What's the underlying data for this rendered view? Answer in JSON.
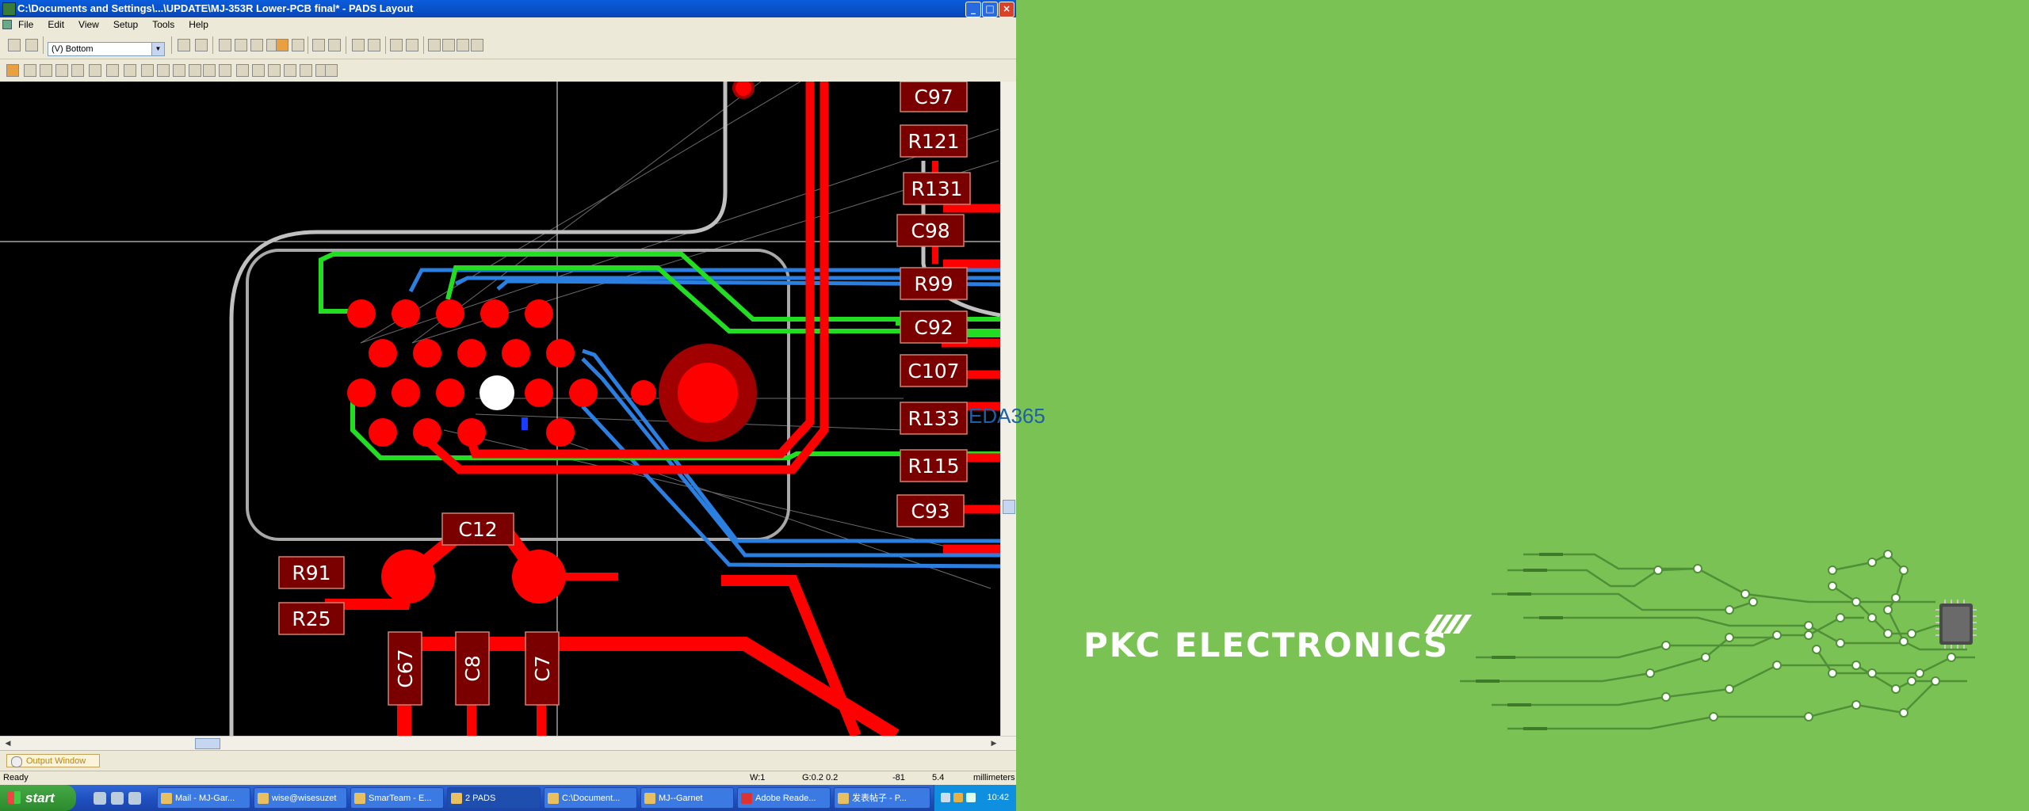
{
  "window": {
    "title": "C:\\Documents and Settings\\...\\UPDATE\\MJ-353R Lower-PCB final* - PADS Layout",
    "controls": [
      "_",
      "□",
      "×"
    ]
  },
  "menu": {
    "items": [
      "File",
      "Edit",
      "View",
      "Setup",
      "Tools",
      "Help"
    ]
  },
  "toolbar": {
    "layer_value": "(V) Bottom"
  },
  "pcb": {
    "components": [
      "C97",
      "R121",
      "R131",
      "C98",
      "R99",
      "C92",
      "C107",
      "R133",
      "R115",
      "C93",
      "C12",
      "R91",
      "R25",
      "C67",
      "C8",
      "C7"
    ],
    "colors": {
      "background": "#000000",
      "copper": "#ff0000",
      "pad_box": "#7a0000",
      "green_trace": "#22dd22",
      "blue_trace": "#2b7fe0",
      "outline": "#b0b0b0"
    }
  },
  "output_window": {
    "label": "Output Window"
  },
  "status": {
    "ready": "Ready",
    "w": "W:1",
    "g": "G:0.2 0.2",
    "x": "-81",
    "y": "5.4",
    "units": "millimeters"
  },
  "taskbar": {
    "start": "start",
    "tasks": [
      "Mail - MJ-Gar...",
      "wise@wisesuzet",
      "SmarTeam - E...",
      "2 PADS",
      "C:\\Document...",
      "MJ--Garnet",
      "Adobe Reade...",
      "发表帖子 - P..."
    ],
    "clock": "10:42"
  },
  "watermark": {
    "text": "EDA365"
  },
  "brand": {
    "name": "PKC ELECTRONICS",
    "accent": "#7bc255"
  }
}
